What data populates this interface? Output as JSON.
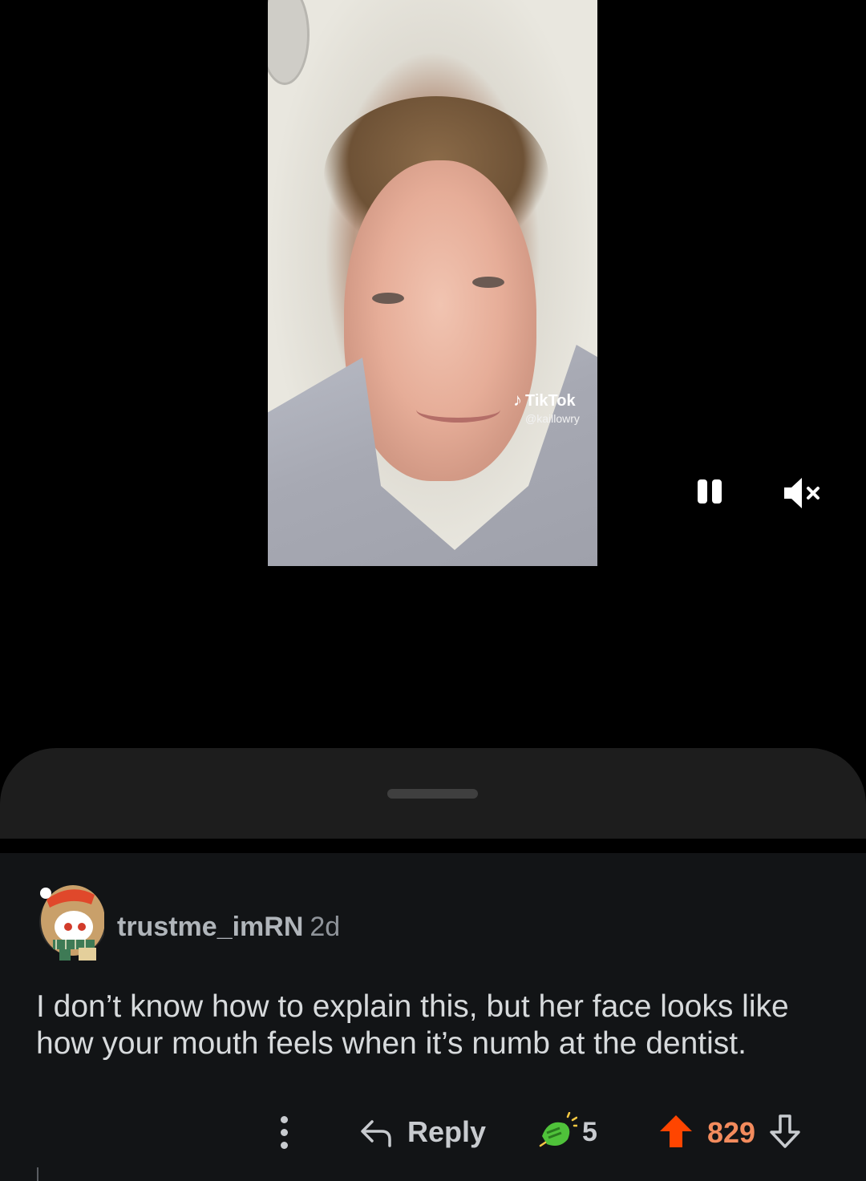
{
  "video": {
    "watermark_brand": "TikTok",
    "watermark_handle": "@kaillowry",
    "controls": {
      "pause_icon": "pause-icon",
      "mute_icon": "volume-muted-icon"
    }
  },
  "comment": {
    "author": "trustme_imRN",
    "age": "2d",
    "body": "I don’t know how to explain this, but her face looks like how your mouth feels when it’s numb at the dentist.",
    "actions": {
      "more_icon": "more-vertical-icon",
      "reply_label": "Reply",
      "reply_icon": "reply-arrow-icon",
      "award_icon": "award-icon",
      "award_count": "5",
      "score": "829",
      "upvote_icon": "upvote-arrow-icon",
      "downvote_icon": "downvote-arrow-icon"
    }
  },
  "colors": {
    "background": "#000000",
    "sheet": "#1d1d1d",
    "comment_bg": "#121416",
    "upvote_accent": "#ff4500",
    "score_color": "#f38b5d",
    "text_primary": "#d7dadc",
    "text_secondary": "#8f949a"
  }
}
